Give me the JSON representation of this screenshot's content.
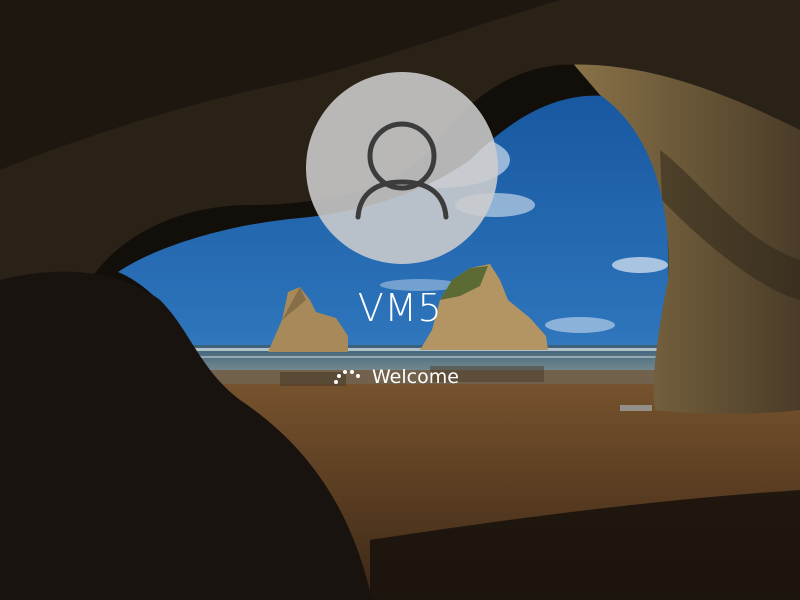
{
  "lock_screen": {
    "user_name": "VM5",
    "status_text": "Welcome",
    "icons": {
      "avatar": "user-silhouette-icon",
      "spinner": "loading-spinner-icon"
    },
    "colors": {
      "text": "#ffffff",
      "avatar_bg": "#cdcdcd",
      "avatar_glyph": "#3c3c3c"
    }
  }
}
